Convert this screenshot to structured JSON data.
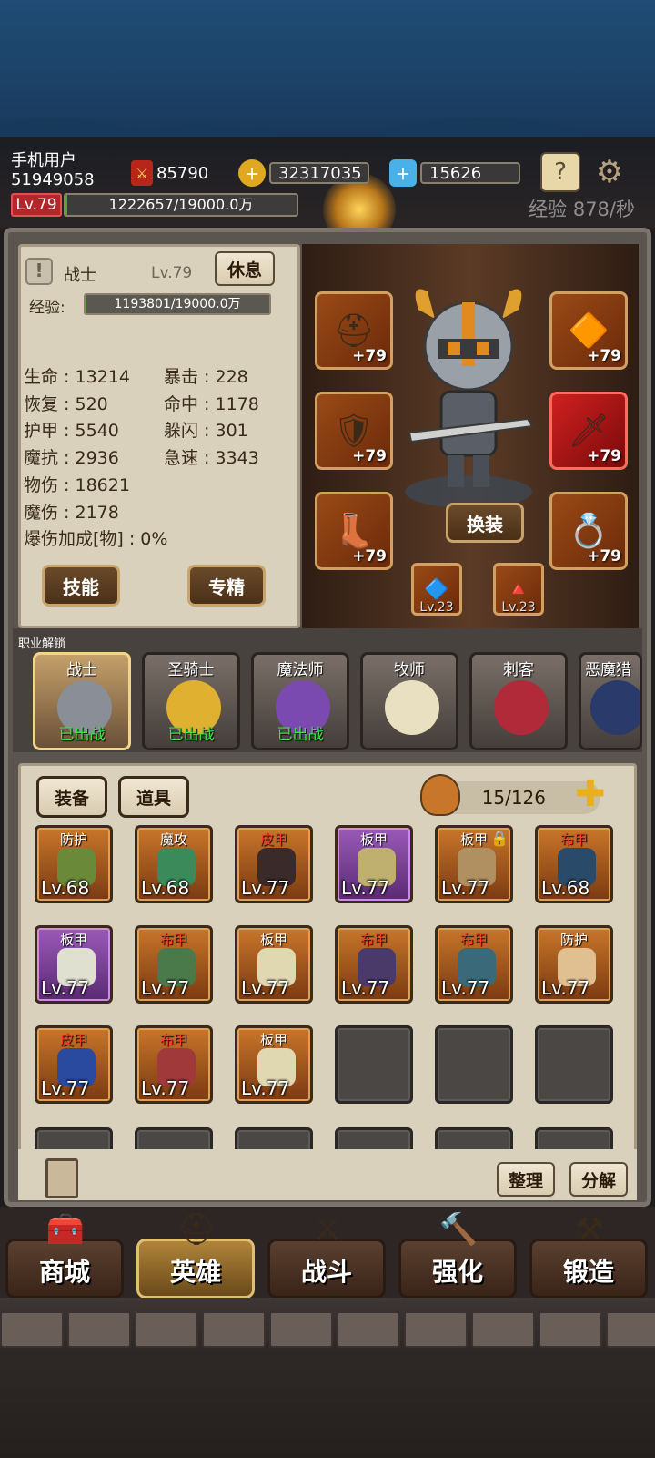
{
  "player": {
    "name": "手机用户",
    "id": "51949058",
    "level": "Lv.79",
    "exp": "1222657/19000.0万",
    "exp_rate": "经验 878/秒"
  },
  "resources": {
    "power": "85790",
    "gold": "32317035",
    "gems": "15626"
  },
  "icons": {
    "power": "sword-shield-icon",
    "gold": "gold-coin-plus-icon",
    "gem": "diamond-plus-icon",
    "guide": "question-book-icon",
    "settings": "gear-icon"
  },
  "hero": {
    "class": "战士",
    "level": "Lv.79",
    "rest_label": "休息",
    "exp_label": "经验:",
    "exp_value": "1193801/19000.0万",
    "stats_left": [
      "生命 : 13214",
      "恢复 : 520",
      "护甲 : 5540",
      "魔抗 : 2936",
      "物伤 : 18621",
      "魔伤 : 2178",
      "爆伤加成[物] : 0%"
    ],
    "stats_right": [
      "暴击 : 228",
      "命中 : 1178",
      "躲闪 : 301",
      "急速 : 3343"
    ],
    "skill_label": "技能",
    "specialize_label": "专精",
    "change_label": "换装"
  },
  "equip_slots": [
    {
      "name": "helmet",
      "plus": "+79"
    },
    {
      "name": "amulet",
      "plus": "+79"
    },
    {
      "name": "armor",
      "plus": "+79"
    },
    {
      "name": "weapon",
      "plus": "+79"
    },
    {
      "name": "boots",
      "plus": "+79"
    },
    {
      "name": "ring",
      "plus": "+79"
    }
  ],
  "gems": [
    {
      "name": "blue-gem",
      "level": "Lv.23"
    },
    {
      "name": "red-gem",
      "level": "Lv.23"
    }
  ],
  "unlock": {
    "label": "职业解锁",
    "classes": [
      {
        "name": "战士",
        "status": "已出战"
      },
      {
        "name": "圣骑士",
        "status": "已出战"
      },
      {
        "name": "魔法师",
        "status": "已出战"
      },
      {
        "name": "牧师",
        "status": ""
      },
      {
        "name": "刺客",
        "status": ""
      },
      {
        "name": "恶魔猎",
        "status": ""
      }
    ]
  },
  "inventory": {
    "tab_equip": "装备",
    "tab_items": "道具",
    "count": "15/126",
    "sort_label": "整理",
    "decompose_label": "分解",
    "items": [
      {
        "type": "防护",
        "level": "Lv.68",
        "red": false,
        "purple": false
      },
      {
        "type": "魔攻",
        "level": "Lv.68",
        "red": false,
        "purple": false
      },
      {
        "type": "皮甲",
        "level": "Lv.77",
        "red": true,
        "purple": false
      },
      {
        "type": "板甲",
        "level": "Lv.77",
        "red": false,
        "purple": true
      },
      {
        "type": "板甲",
        "level": "Lv.77",
        "red": false,
        "purple": false
      },
      {
        "type": "布甲",
        "level": "Lv.68",
        "red": true,
        "purple": false
      },
      {
        "type": "板甲",
        "level": "Lv.77",
        "red": false,
        "purple": true
      },
      {
        "type": "布甲",
        "level": "Lv.77",
        "red": true,
        "purple": false
      },
      {
        "type": "板甲",
        "level": "Lv.77",
        "red": false,
        "purple": false
      },
      {
        "type": "布甲",
        "level": "Lv.77",
        "red": true,
        "purple": false
      },
      {
        "type": "布甲",
        "level": "Lv.77",
        "red": true,
        "purple": false
      },
      {
        "type": "防护",
        "level": "Lv.77",
        "red": false,
        "purple": false
      },
      {
        "type": "皮甲",
        "level": "Lv.77",
        "red": true,
        "purple": false
      },
      {
        "type": "布甲",
        "level": "Lv.77",
        "red": true,
        "purple": false
      },
      {
        "type": "板甲",
        "level": "Lv.77",
        "red": false,
        "purple": false
      }
    ]
  },
  "nav": {
    "shop": "商城",
    "hero": "英雄",
    "battle": "战斗",
    "enhance": "强化",
    "forge": "锻造"
  }
}
